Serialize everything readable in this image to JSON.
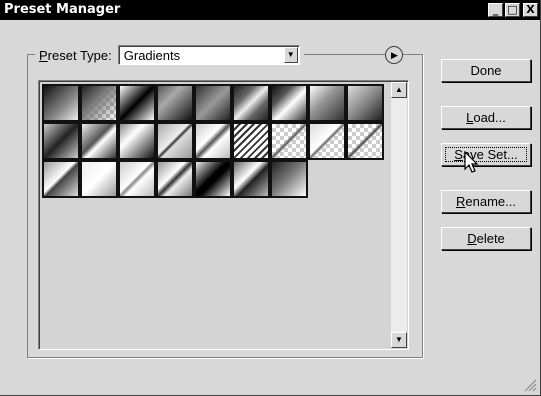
{
  "window": {
    "title": "Preset Manager",
    "controls": {
      "minimize": "_",
      "maximize": "□",
      "close": "X"
    }
  },
  "preset_type": {
    "label": "Preset Type:",
    "mnemonic": "P",
    "value": "Gradients",
    "arrow_icon": "dropdown-arrow-icon",
    "menu_icon": "circle-arrow-icon"
  },
  "gradients": [
    {
      "fill": "linear-gradient(135deg, #111 0%, #888 60%, #eee 100%)"
    },
    {
      "fill": "linear-gradient(135deg, #222 0%, #777 40%, rgba(255,255,255,0) 100%), repeating-conic-gradient(#bbb 0% 25%, #fff 0% 50%) 0 0/8px 8px"
    },
    {
      "fill": "linear-gradient(135deg, #fff 0%, #000 50%, #fff 100%)"
    },
    {
      "fill": "linear-gradient(135deg, #555 0%, #aaa 35%, #111 100%)"
    },
    {
      "fill": "linear-gradient(135deg, #333 0%, #999 50%, #222 100%)"
    },
    {
      "fill": "linear-gradient(135deg, #222 0%, #666 30%, #eee 50%, #666 70%, #222 100%)"
    },
    {
      "fill": "linear-gradient(135deg, #111 0%, #555 30%, #ddd 50%, #fff 55%, #333 100%)"
    },
    {
      "fill": "linear-gradient(135deg, #fff 0%, #999 40%, #333 100%)"
    },
    {
      "fill": "linear-gradient(135deg, #ddd 0%, #888 50%, #222 100%)"
    },
    {
      "fill": "linear-gradient(135deg, #ccc 0%, #222 50%, #ccc 100%)"
    },
    {
      "fill": "linear-gradient(135deg, #eee 0%, #555 45%, #fff 55%, #333 100%)"
    },
    {
      "fill": "linear-gradient(135deg, #888 0%, #fff 35%, #111 100%)"
    },
    {
      "fill": "linear-gradient(135deg, #aaa 0%, #eee 45%, #333 50%, #ddd 55%, #999 100%)"
    },
    {
      "fill": "linear-gradient(135deg, #ccc 0%, #fff 40%, #555 50%, #fff 60%, #bbb 100%)"
    },
    {
      "fill": "repeating-linear-gradient(135deg, #fff 0px, #fff 3px, #333 3px, #333 5px)"
    },
    {
      "fill": "linear-gradient(135deg, rgba(255,255,255,0) 45%, #555 50%, rgba(255,255,255,0) 55%), repeating-conic-gradient(#ccc 0% 25%, #fff 0% 50%) 0 0/8px 8px"
    },
    {
      "fill": "linear-gradient(135deg, #ddd 0%, #fff 45%, #666 50%, rgba(255,255,255,0) 55%), repeating-conic-gradient(#ccc 0% 25%, #fff 0% 50%) 0 0/8px 8px"
    },
    {
      "fill": "linear-gradient(135deg, rgba(255,255,255,0) 45%, #444 50%, rgba(255,255,255,0) 55%), repeating-conic-gradient(#ccc 0% 25%, #fff 0% 50%) 0 0/8px 8px"
    },
    {
      "fill": "linear-gradient(135deg, #999 0%, #fff 45%, #444 52%, #ddd 100%)"
    },
    {
      "fill": "linear-gradient(135deg, #eee 0%, #fff 50%, #999 100%)"
    },
    {
      "fill": "linear-gradient(135deg, #ccc 0%, #fff 45%, #888 50%, #fff 58%, #bbb 100%)"
    },
    {
      "fill": "linear-gradient(135deg, #999 0%, #fff 40%, #333 50%, #eee 60%, #777 100%)"
    },
    {
      "fill": "linear-gradient(135deg, #eee 0%, #000 45%, #000 55%, #fff 100%)"
    },
    {
      "fill": "linear-gradient(135deg, #666 0%, #fff 40%, #222 55%, #bbb 100%)"
    },
    {
      "fill": "linear-gradient(135deg, #222 0%, #777 45%, #fff 100%)"
    }
  ],
  "buttons": {
    "done": "Done",
    "load": "Load...",
    "load_mnemonic": "L",
    "save_set": "Save Set...",
    "save_set_mnemonic": "S",
    "rename": "Rename...",
    "rename_mnemonic": "R",
    "delete": "Delete",
    "delete_mnemonic": "D"
  },
  "icons": {
    "cursor": "mouse-pointer-icon",
    "grip": "resize-grip-icon",
    "scroll_up": "scroll-up-arrow-icon",
    "scroll_down": "scroll-down-arrow-icon"
  }
}
